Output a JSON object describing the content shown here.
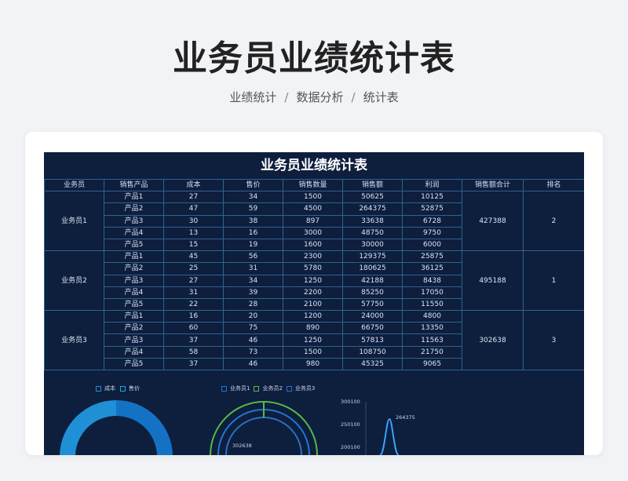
{
  "page": {
    "title": "业务员业绩统计表",
    "breadcrumb": [
      "业绩统计",
      "数据分析",
      "统计表"
    ]
  },
  "sheet": {
    "title": "业务员业绩统计表",
    "headers": [
      "业务员",
      "销售产品",
      "成本",
      "售价",
      "销售数量",
      "销售额",
      "利润",
      "销售额合计",
      "排名"
    ],
    "groups": [
      {
        "name": "业务员1",
        "total": "427388",
        "rank": "2",
        "rows": [
          [
            "产品1",
            "27",
            "34",
            "1500",
            "50625",
            "10125"
          ],
          [
            "产品2",
            "47",
            "59",
            "4500",
            "264375",
            "52875"
          ],
          [
            "产品3",
            "30",
            "38",
            "897",
            "33638",
            "6728"
          ],
          [
            "产品4",
            "13",
            "16",
            "3000",
            "48750",
            "9750"
          ],
          [
            "产品5",
            "15",
            "19",
            "1600",
            "30000",
            "6000"
          ]
        ]
      },
      {
        "name": "业务员2",
        "total": "495188",
        "rank": "1",
        "rows": [
          [
            "产品1",
            "45",
            "56",
            "2300",
            "129375",
            "25875"
          ],
          [
            "产品2",
            "25",
            "31",
            "5780",
            "180625",
            "36125"
          ],
          [
            "产品3",
            "27",
            "34",
            "1250",
            "42188",
            "8438"
          ],
          [
            "产品4",
            "31",
            "39",
            "2200",
            "85250",
            "17050"
          ],
          [
            "产品5",
            "22",
            "28",
            "2100",
            "57750",
            "11550"
          ]
        ]
      },
      {
        "name": "业务员3",
        "total": "302638",
        "rank": "3",
        "rows": [
          [
            "产品1",
            "16",
            "20",
            "1200",
            "24000",
            "4800"
          ],
          [
            "产品2",
            "60",
            "75",
            "890",
            "66750",
            "13350"
          ],
          [
            "产品3",
            "37",
            "46",
            "1250",
            "57813",
            "11563"
          ],
          [
            "产品4",
            "58",
            "73",
            "1500",
            "108750",
            "21750"
          ],
          [
            "产品5",
            "37",
            "46",
            "980",
            "45325",
            "9065"
          ]
        ]
      }
    ]
  },
  "colors": {
    "sheet_bg": "#0e1e3d",
    "grid_line": "#2b6590",
    "series_cost": "#1f8fd6",
    "series_price": "#1aa6e0",
    "series_s1": "#1e78d0",
    "series_s2": "#58b84a",
    "series_s3": "#2d6fbf"
  },
  "chart_data": [
    {
      "type": "pie",
      "legend": [
        "成本",
        "售价"
      ],
      "legend_position": "top",
      "visible": "partial"
    },
    {
      "type": "pie",
      "legend": [
        "业务员1",
        "业务员2",
        "业务员3"
      ],
      "legend_position": "top",
      "categories": [
        "业务员1",
        "业务员2",
        "业务员3"
      ],
      "values": [
        427388,
        495188,
        302638
      ],
      "data_labels": [
        "302638"
      ],
      "visible": "partial"
    },
    {
      "type": "line",
      "ylim": [
        200100,
        300100
      ],
      "y_ticks": [
        "300100",
        "250100",
        "200100"
      ],
      "peak_label": "264375",
      "peak_value": 264375,
      "visible": "partial"
    }
  ]
}
